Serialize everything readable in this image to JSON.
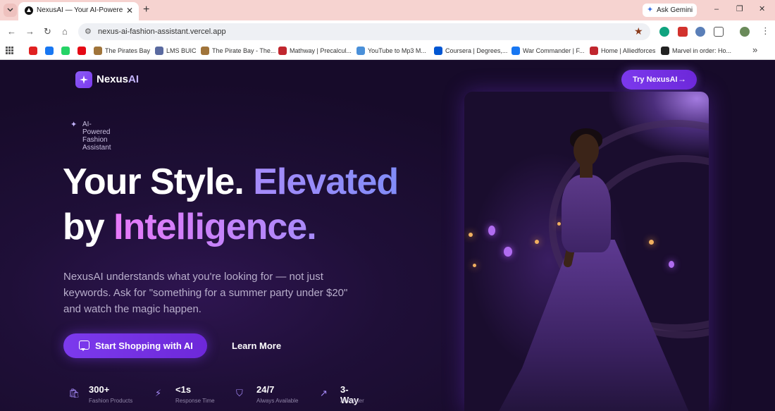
{
  "browser": {
    "tab_title": "NexusAI — Your AI-Powered St",
    "tab_close": "✕",
    "new_tab": "+",
    "ask_gemini": "Ask Gemini",
    "url": "nexus-ai-fashion-assistant.vercel.app",
    "window_controls": [
      "–",
      "❐",
      "✕"
    ],
    "bookmarks": [
      {
        "label": "",
        "color": "#e02020",
        "icon": "youtube-icon"
      },
      {
        "label": "",
        "color": "#1877f2",
        "icon": "facebook-icon"
      },
      {
        "label": "",
        "color": "#25d366",
        "icon": "whatsapp-icon"
      },
      {
        "label": "",
        "color": "#e50914",
        "icon": "netflix-icon"
      },
      {
        "label": "The Pirates Bay",
        "color": "#a0743a",
        "icon": "pirate-ship-icon"
      },
      {
        "label": "LMS BUIC",
        "color": "#5a6aa0",
        "icon": "lms-icon"
      },
      {
        "label": "The Pirate Bay - The...",
        "color": "#a0743a",
        "icon": "pirate-ship-icon"
      },
      {
        "label": "Mathway | Precalcul...",
        "color": "#c0262e",
        "icon": "mathway-icon"
      },
      {
        "label": "YouTube to Mp3 M...",
        "color": "#4a90d9",
        "icon": "cloud-download-icon"
      },
      {
        "label": "Coursera | Degrees,...",
        "color": "#0056d2",
        "icon": "coursera-icon"
      },
      {
        "label": "War Commander | F...",
        "color": "#1877f2",
        "icon": "facebook-icon"
      },
      {
        "label": "Home | Alliedforces",
        "color": "#c0262e",
        "icon": "alliedforces-icon"
      },
      {
        "label": "Marvel in order: Ho...",
        "color": "#222222",
        "icon": "ds-icon"
      }
    ],
    "bookmarks_more": "»"
  },
  "nav": {
    "logo_prefix": "Nexus",
    "logo_suffix": "AI",
    "cta": "Try NexusAI",
    "cta_arrow": "→"
  },
  "hero": {
    "badge": "AI-Powered Fashion Assistant",
    "headline_1": "Your Style.",
    "headline_2": "Elevated",
    "headline_3": "by",
    "headline_4": "Intelligence.",
    "description": "NexusAI understands what you're looking for — not just keywords. Ask for \"something for a summer party under $20\" and watch the magic happen.",
    "primary_cta": "Start Shopping with AI",
    "secondary_cta": "Learn More",
    "image_alt": "Woman in flowing purple gown on a grand staircase"
  },
  "stats": [
    {
      "value": "300+",
      "label": "Fashion Products",
      "icon": "shopping-bag-icon"
    },
    {
      "value": "<1s",
      "label": "Response Time",
      "icon": "lightning-icon"
    },
    {
      "value": "24/7",
      "label": "Always Available",
      "icon": "shield-icon"
    },
    {
      "value": "3-Way",
      "label": "AI Router",
      "icon": "trending-up-icon"
    }
  ],
  "colors": {
    "accent": "#7c3aed",
    "gradient_start": "#a78bfa",
    "gradient_pink": "#e879f9",
    "background": "#1a0d2e"
  }
}
